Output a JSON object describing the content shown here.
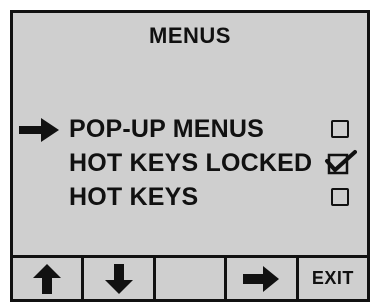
{
  "screen": {
    "title": "MENUS",
    "items": [
      {
        "label": "POP-UP MENUS",
        "checked": false,
        "selected": true
      },
      {
        "label": "HOT KEYS LOCKED",
        "checked": true,
        "selected": false
      },
      {
        "label": "HOT KEYS",
        "checked": false,
        "selected": false
      }
    ]
  },
  "softkeys": [
    {
      "icon": "arrow-up-icon"
    },
    {
      "icon": "arrow-down-icon"
    },
    {
      "icon": ""
    },
    {
      "icon": "arrow-right-icon"
    },
    {
      "label": "EXIT"
    }
  ],
  "colors": {
    "lcd_background": "#cfcfcf",
    "foreground": "#111111"
  }
}
